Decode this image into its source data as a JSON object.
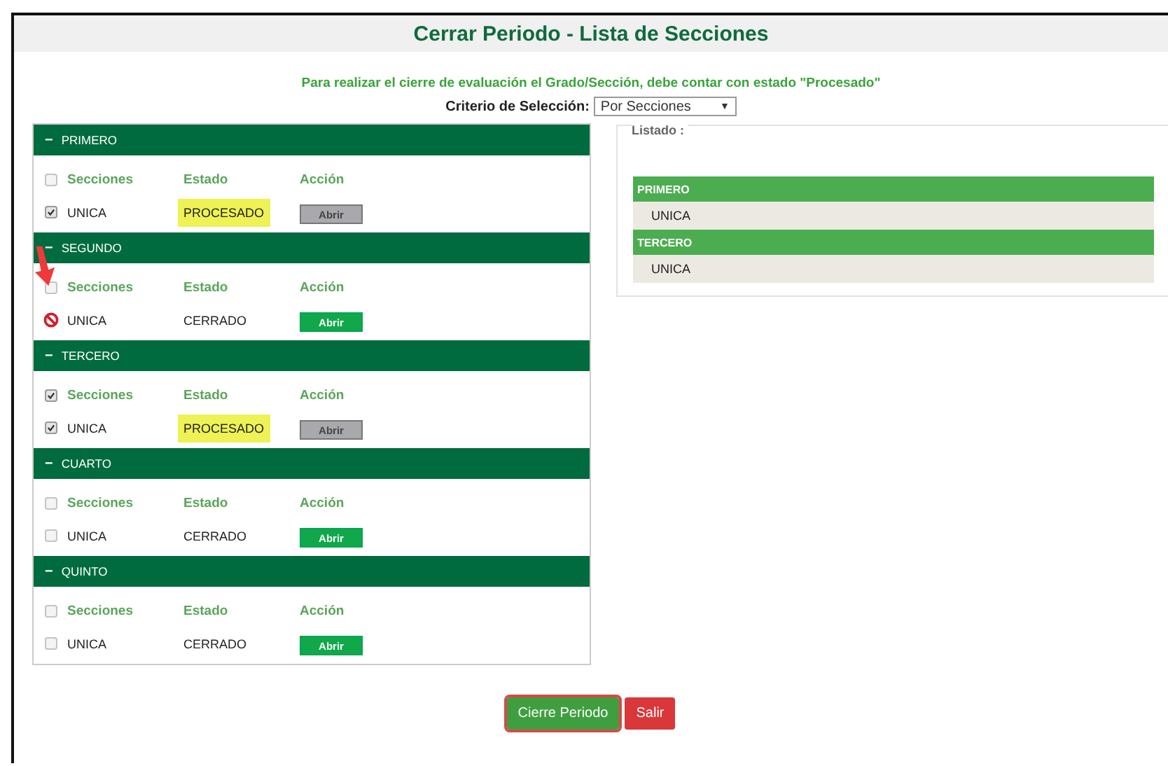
{
  "title": "Cerrar Periodo - Lista de Secciones",
  "notice": "Para realizar el cierre de evaluación el Grado/Sección, debe contar con estado \"Procesado\"",
  "criterion": {
    "label": "Criterio de Selección:",
    "value": "Por Secciones",
    "arrow": "▼"
  },
  "sections": [
    {
      "name": "PRIMERO",
      "expanded": true,
      "toggle": "−",
      "header_checked": false,
      "columns": [
        "Secciones",
        "Estado",
        "Acción"
      ],
      "rows": [
        {
          "kind": "checkbox",
          "name": "UNICA",
          "checked": true,
          "status": "PROCESADO",
          "highlighted": true,
          "button": "Abrir",
          "disabled": true
        }
      ]
    },
    {
      "name": "SEGUNDO",
      "expanded": true,
      "toggle": "−",
      "header_checked": false,
      "columns": [
        "Secciones",
        "Estado",
        "Acción"
      ],
      "rows": [
        {
          "kind": "blocked",
          "name": "UNICA",
          "status": "CERRADO",
          "highlighted": false,
          "button": "Abrir",
          "disabled": false,
          "pointer_arrow": true
        }
      ]
    },
    {
      "name": "TERCERO",
      "expanded": true,
      "toggle": "−",
      "header_checked": true,
      "columns": [
        "Secciones",
        "Estado",
        "Acción"
      ],
      "rows": [
        {
          "kind": "checkbox",
          "name": "UNICA",
          "checked": true,
          "status": "PROCESADO",
          "highlighted": true,
          "button": "Abrir",
          "disabled": true
        }
      ]
    },
    {
      "name": "CUARTO",
      "expanded": true,
      "toggle": "−",
      "header_checked": false,
      "columns": [
        "Secciones",
        "Estado",
        "Acción"
      ],
      "rows": [
        {
          "kind": "checkbox",
          "name": "UNICA",
          "checked": false,
          "status": "CERRADO",
          "highlighted": false,
          "button": "Abrir",
          "disabled": false
        }
      ]
    },
    {
      "name": "QUINTO",
      "expanded": true,
      "toggle": "−",
      "header_checked": false,
      "columns": [
        "Secciones",
        "Estado",
        "Acción"
      ],
      "rows": [
        {
          "kind": "checkbox",
          "name": "UNICA",
          "checked": false,
          "status": "CERRADO",
          "highlighted": false,
          "button": "Abrir",
          "disabled": false
        }
      ]
    }
  ],
  "listing": {
    "legend": "Listado :",
    "groups": [
      {
        "name": "PRIMERO",
        "items": [
          "UNICA"
        ]
      },
      {
        "name": "TERCERO",
        "items": [
          "UNICA"
        ]
      }
    ]
  },
  "buttons": [
    {
      "kind": "primary",
      "label": "Cierre Periodo",
      "highlighted": true
    },
    {
      "kind": "danger",
      "label": "Salir",
      "highlighted": false
    }
  ]
}
